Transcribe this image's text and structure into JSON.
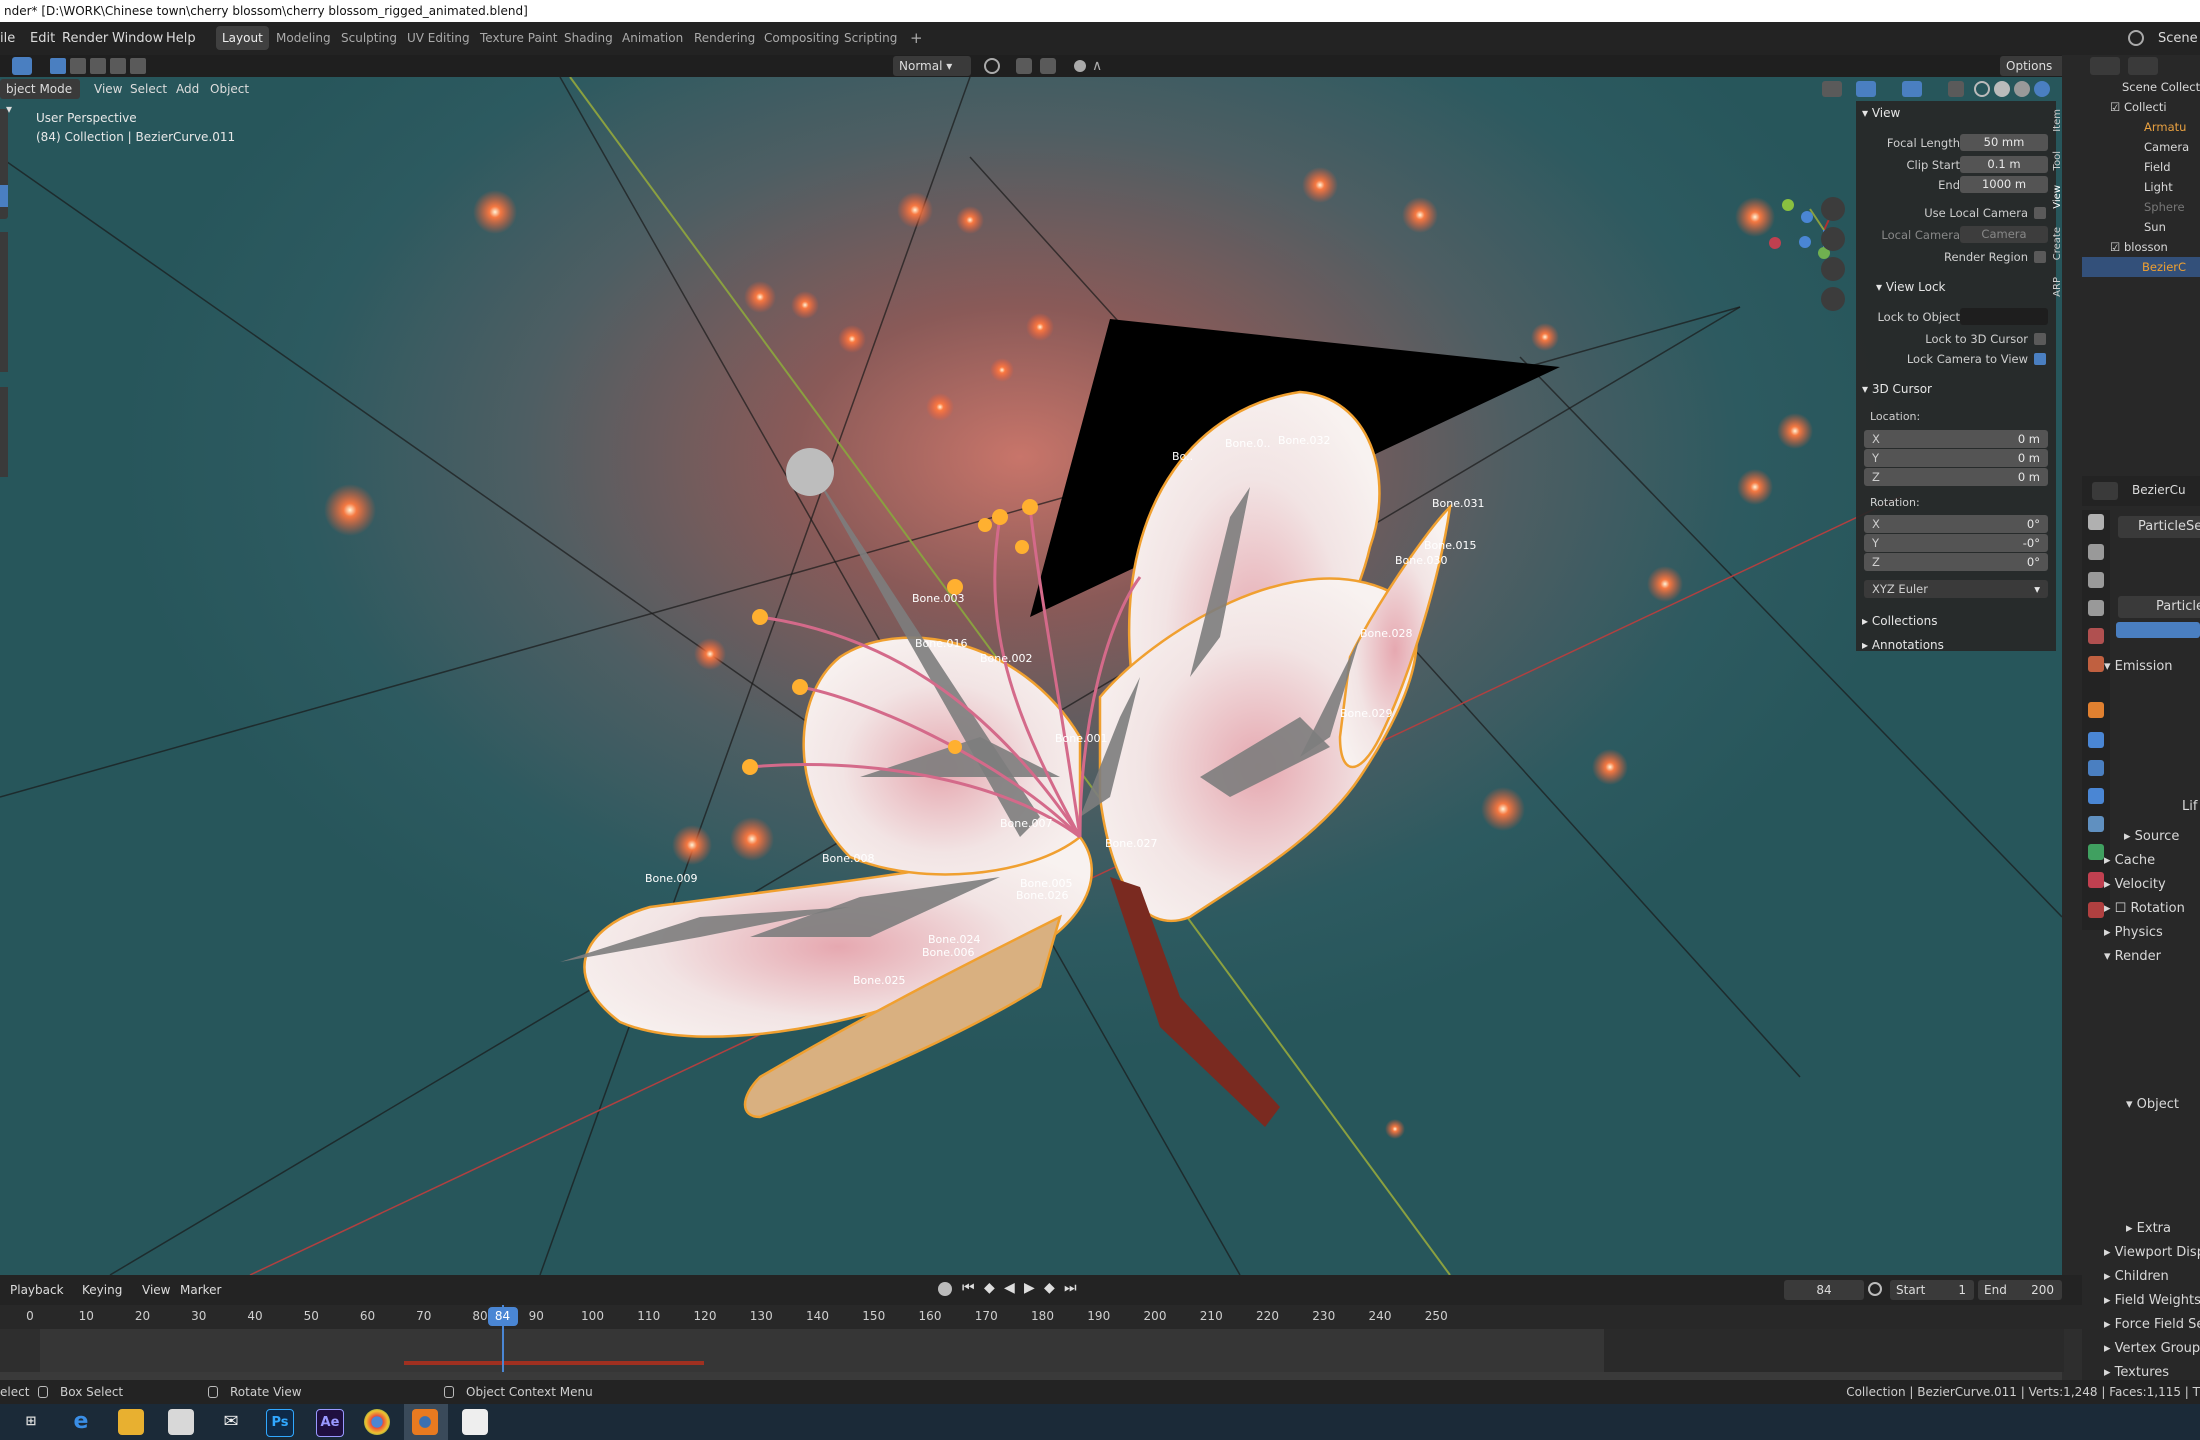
{
  "window_title": "nder* [D:\\WORK\\Chinese town\\cherry blossom\\cherry blossom_rigged_animated.blend]",
  "menu": [
    "ile",
    "Edit",
    "Render",
    "Window",
    "Help"
  ],
  "workspaces": [
    "Layout",
    "Modeling",
    "Sculpting",
    "UV Editing",
    "Texture Paint",
    "Shading",
    "Animation",
    "Rendering",
    "Compositing",
    "Scripting"
  ],
  "workspace_add": "+",
  "scene_label": "Scene",
  "header": {
    "transform_orientation": "Normal",
    "options": "Options",
    "mode": "bject Mode",
    "view": "View",
    "select": "Select",
    "add": "Add",
    "object": "Object"
  },
  "viewport": {
    "perspective": "User Perspective",
    "collection": "(84) Collection | BezierCurve.011",
    "axes": {
      "x": "X",
      "y": "Y",
      "z": "Z"
    },
    "bone_labels": [
      "Bone.003",
      "Bone.016",
      "Bone.002",
      "Bone.001",
      "Bone.007",
      "Bone.027",
      "Bone.008",
      "Bone.005",
      "Bone.026",
      "Bone.024",
      "Bone.006",
      "Bone.025",
      "Bone.009",
      "Bone.028",
      "Bone.029",
      "Bone.015",
      "Bone.030",
      "Bone.032",
      "Bone.031",
      "Bo..",
      "Bone.0.."
    ]
  },
  "npanel": {
    "tabs": [
      "Item",
      "Tool",
      "View",
      "Create",
      "ARP"
    ],
    "view_title": "View",
    "focal_length_label": "Focal Length",
    "focal_length": "50 mm",
    "clip_start_label": "Clip Start",
    "clip_start": "0.1 m",
    "end_label": "End",
    "end": "1000 m",
    "use_local_camera": "Use Local Camera",
    "local_camera_label": "Local Camera",
    "local_camera_value": "Camera",
    "render_region": "Render Region",
    "view_lock_title": "View Lock",
    "lock_to_object": "Lock to Object",
    "lock_to_3d_cursor": "Lock to 3D Cursor",
    "lock_camera_to_view": "Lock Camera to View",
    "cursor_title": "3D Cursor",
    "location_label": "Location:",
    "loc": [
      {
        "k": "X",
        "v": "0 m"
      },
      {
        "k": "Y",
        "v": "0 m"
      },
      {
        "k": "Z",
        "v": "0 m"
      }
    ],
    "rotation_label": "Rotation:",
    "rot": [
      {
        "k": "X",
        "v": "0°"
      },
      {
        "k": "Y",
        "v": "-0°"
      },
      {
        "k": "Z",
        "v": "0°"
      }
    ],
    "rotation_mode": "XYZ Euler",
    "collections": "Collections",
    "annotations": "Annotations"
  },
  "outliner": {
    "items": [
      "Scene Collectio",
      "Collecti",
      "Armatu",
      "Camera",
      "Field",
      "Light",
      "Sphere",
      "Sun",
      "blosson",
      "BezierC"
    ]
  },
  "properties": {
    "object_name": "BezierCu",
    "particle_slot": "ParticleSet",
    "particle_settings": "ParticleSe",
    "emission": "Emission",
    "lif": "Lif",
    "source": "Source",
    "cache": "Cache",
    "velocity": "Velocity",
    "rotation": "Rotation",
    "physics": "Physics",
    "render": "Render",
    "object": "Object",
    "extra": "Extra",
    "viewport_display": "Viewport Disp",
    "children": "Children",
    "field_weights": "Field Weights",
    "force_field": "Force Field Se",
    "vertex_groups": "Vertex Group",
    "textures": "Textures"
  },
  "timeline": {
    "playback": "Playback",
    "keying": "Keying",
    "view": "View",
    "marker": "Marker",
    "current_frame": "84",
    "start_label": "Start",
    "start": "1",
    "end_label": "End",
    "end": "200",
    "ticks": [
      "0",
      "10",
      "20",
      "30",
      "40",
      "50",
      "60",
      "70",
      "80",
      "90",
      "100",
      "110",
      "120",
      "130",
      "140",
      "150",
      "160",
      "170",
      "180",
      "190",
      "200",
      "210",
      "220",
      "230",
      "240",
      "250"
    ],
    "playhead": "84"
  },
  "status": {
    "select": "elect",
    "box_select": "Box Select",
    "rotate_view": "Rotate View",
    "context_menu": "Object Context Menu",
    "stats": "Collection | BezierCurve.011 | Verts:1,248 | Faces:1,115 | T"
  },
  "taskbar": [
    "task-view",
    "edge",
    "explorer",
    "store",
    "mail",
    "Ps",
    "Ae",
    "chrome",
    "blender",
    "photos"
  ],
  "colors": {
    "accent": "#4a7fc1",
    "playhead": "#4a86d4",
    "selection_outline": "#f0a030",
    "bone": "#7d7d7d"
  }
}
